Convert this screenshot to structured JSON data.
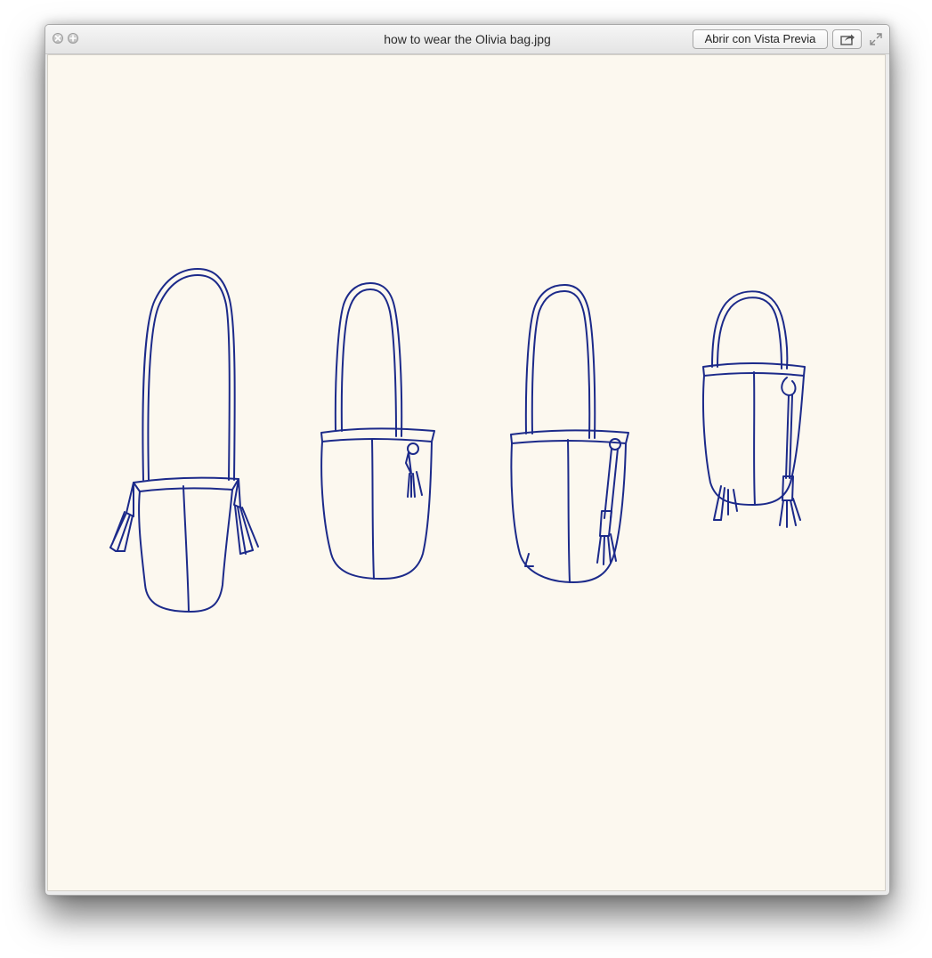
{
  "window": {
    "title": "how to wear the Olivia bag.jpg"
  },
  "toolbar": {
    "open_with_label": "Abrir con Vista Previa",
    "share_icon": "share-icon",
    "fullscreen_icon": "expand-icon"
  },
  "colors": {
    "ink": "#1c2a8a",
    "paper": "#fcf8ef"
  }
}
